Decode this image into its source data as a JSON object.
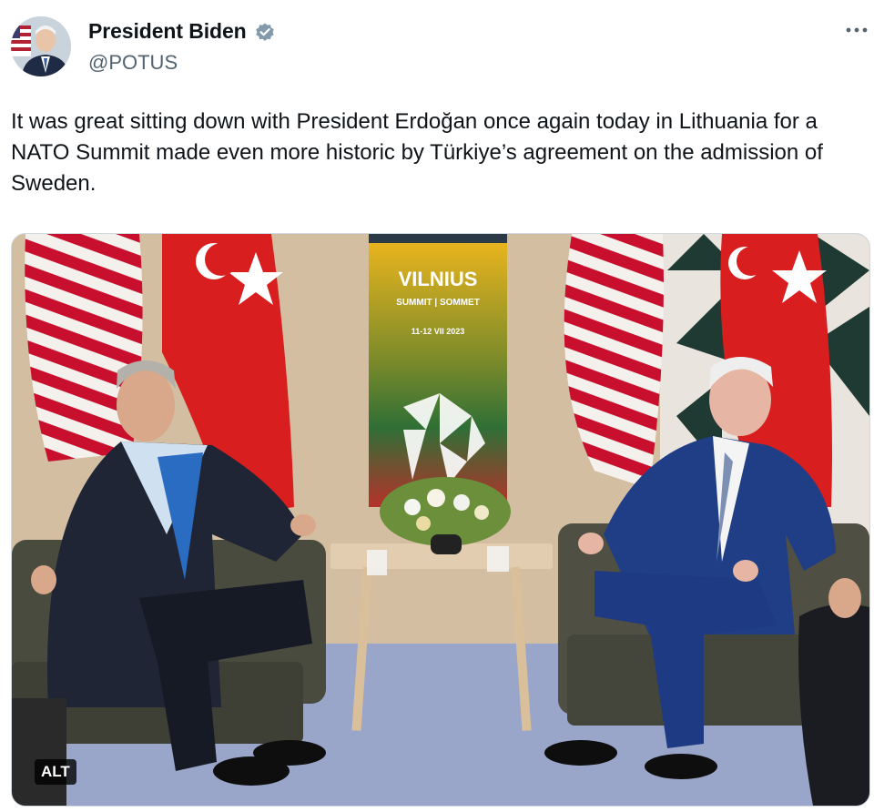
{
  "author": {
    "display_name": "President Biden",
    "handle": "@POTUS",
    "verified_icon": "verified-badge-icon",
    "verified_color": "#829aab"
  },
  "tweet": {
    "text": "It was great sitting down with President Erdoğan once again today in Lithuania for a NATO Summit made even more historic by Türkiye’s agreement on the admission of Sweden."
  },
  "media": {
    "banner_title": "VILNIUS",
    "banner_subtitle": "SUMMIT | SOMMET",
    "banner_dates": "11-12 VII 2023",
    "alt_label": "ALT"
  },
  "icons": {
    "more": "more-options-icon"
  }
}
